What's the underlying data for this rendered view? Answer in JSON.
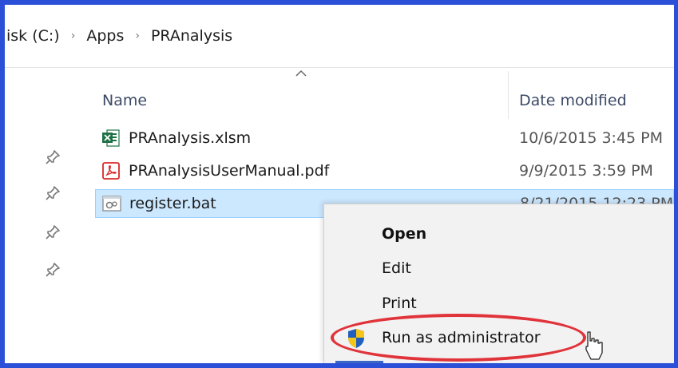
{
  "breadcrumb": {
    "items": [
      "isk (C:)",
      "Apps",
      "PRAnalysis"
    ],
    "separator": "›"
  },
  "columns": {
    "name": "Name",
    "date_modified": "Date modified"
  },
  "files": [
    {
      "name": "PRAnalysis.xlsm",
      "date": "10/6/2015 3:45 PM",
      "icon": "excel-file-icon"
    },
    {
      "name": "PRAnalysisUserManual.pdf",
      "date": "9/9/2015 3:59 PM",
      "icon": "pdf-file-icon"
    },
    {
      "name": "register.bat",
      "date": "8/21/2015 12:23 PM",
      "icon": "batch-file-icon",
      "selected": true
    }
  ],
  "context_menu": {
    "items": [
      {
        "label": "Open",
        "bold": true
      },
      {
        "label": "Edit"
      },
      {
        "label": "Print"
      },
      {
        "label": "Run as administrator",
        "icon": "uac-shield-icon"
      }
    ]
  },
  "colors": {
    "frame": "#2b4fd6",
    "selection": "#cce8ff",
    "highlight": "#e0333a",
    "menu_bg": "#f2f2f2"
  }
}
